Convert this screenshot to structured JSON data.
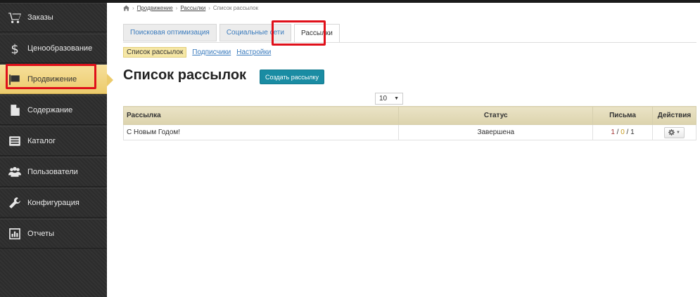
{
  "sidebar": {
    "items": [
      {
        "label": "Заказы",
        "icon": "cart-icon"
      },
      {
        "label": "Ценообразование",
        "icon": "dollar-icon"
      },
      {
        "label": "Продвижение",
        "icon": "flag-icon",
        "active": true
      },
      {
        "label": "Содержание",
        "icon": "document-icon"
      },
      {
        "label": "Каталог",
        "icon": "catalog-icon"
      },
      {
        "label": "Пользователи",
        "icon": "users-icon"
      },
      {
        "label": "Конфигурация",
        "icon": "wrench-icon"
      },
      {
        "label": "Отчеты",
        "icon": "chart-icon"
      }
    ]
  },
  "breadcrumb": {
    "home_icon": "home-icon",
    "items": [
      "Продвижение",
      "Рассылки",
      "Список рассылок"
    ]
  },
  "tabs": [
    {
      "label": "Поисковая оптимизация"
    },
    {
      "label": "Социальные сети"
    },
    {
      "label": "Рассылки",
      "active": true
    }
  ],
  "subnav": {
    "current": "Список рассылок",
    "links": [
      "Подписчики",
      "Настройки"
    ]
  },
  "page": {
    "title": "Список рассылок",
    "create_button": "Создать рассылку",
    "per_page": "10"
  },
  "table": {
    "headers": [
      "Рассылка",
      "Статус",
      "Письма",
      "Действия"
    ],
    "rows": [
      {
        "name": "С Новым Годом!",
        "status": "Завершена",
        "letters": [
          "1",
          "0",
          "1"
        ]
      }
    ]
  },
  "colors": {
    "accent": "#1a8ca3",
    "highlight": "#e0101a",
    "active_nav": "#eccb6c"
  }
}
